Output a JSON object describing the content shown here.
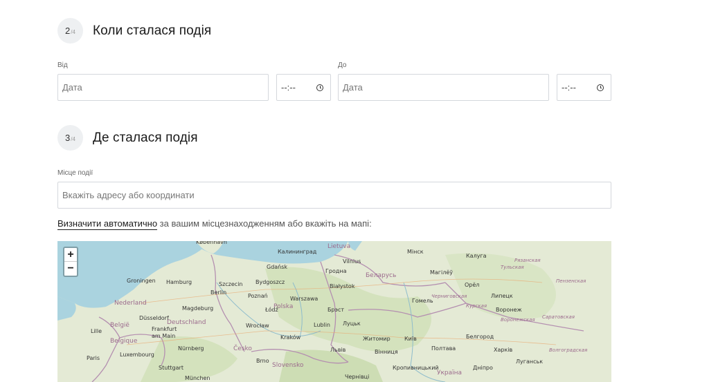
{
  "step2": {
    "number": "2",
    "total": "/4",
    "title": "Коли сталася подія"
  },
  "from": {
    "label": "Від",
    "date_placeholder": "Дата",
    "time_value": "--:--",
    "time_icon": "clock-icon"
  },
  "to": {
    "label": "До",
    "date_placeholder": "Дата",
    "time_value": "--:--",
    "time_icon": "clock-icon"
  },
  "step3": {
    "number": "3",
    "total": "/4",
    "title": "Де сталася подія"
  },
  "location": {
    "label": "Місце події",
    "placeholder": "Вкажіть адресу або координати"
  },
  "auto": {
    "link": "Визначити автоматично",
    "rest": " за вашим місцезнаходженням або вкажіть на мапі:"
  },
  "map": {
    "zoom_in": "+",
    "zoom_out": "−",
    "countries": [
      "Lietuva",
      "Беларусь",
      "Polska",
      "Deutschland",
      "Nederland",
      "België Belgique",
      "Luxembourg",
      "Česko",
      "Slovensko",
      "Україна"
    ],
    "cities": [
      "København",
      "Калининград",
      "Vilnius",
      "Gdańsk",
      "Гродна",
      "Мінск",
      "Калуга",
      "Hamburg",
      "Szczecin",
      "Bydgoszcz",
      "Białystok",
      "Магілёў",
      "Орёл",
      "Berlin",
      "Poznań",
      "Warszawa",
      "Брэст",
      "Гомель",
      "Липецк",
      "Воронеж",
      "Magdeburg",
      "Łódź",
      "Lublin",
      "Луцьк",
      "Житомир",
      "Київ",
      "Белгород",
      "Düsseldorf",
      "Wrocław",
      "Kraków",
      "Львів",
      "Вінниця",
      "Полтава",
      "Харків",
      "Frankfurt am Main",
      "Nürnberg",
      "Stuttgart",
      "München",
      "Brno",
      "Кропивницький",
      "Дніпро",
      "Луганськ",
      "Чернівці",
      "Groningen",
      "Paris",
      "Lille"
    ]
  }
}
